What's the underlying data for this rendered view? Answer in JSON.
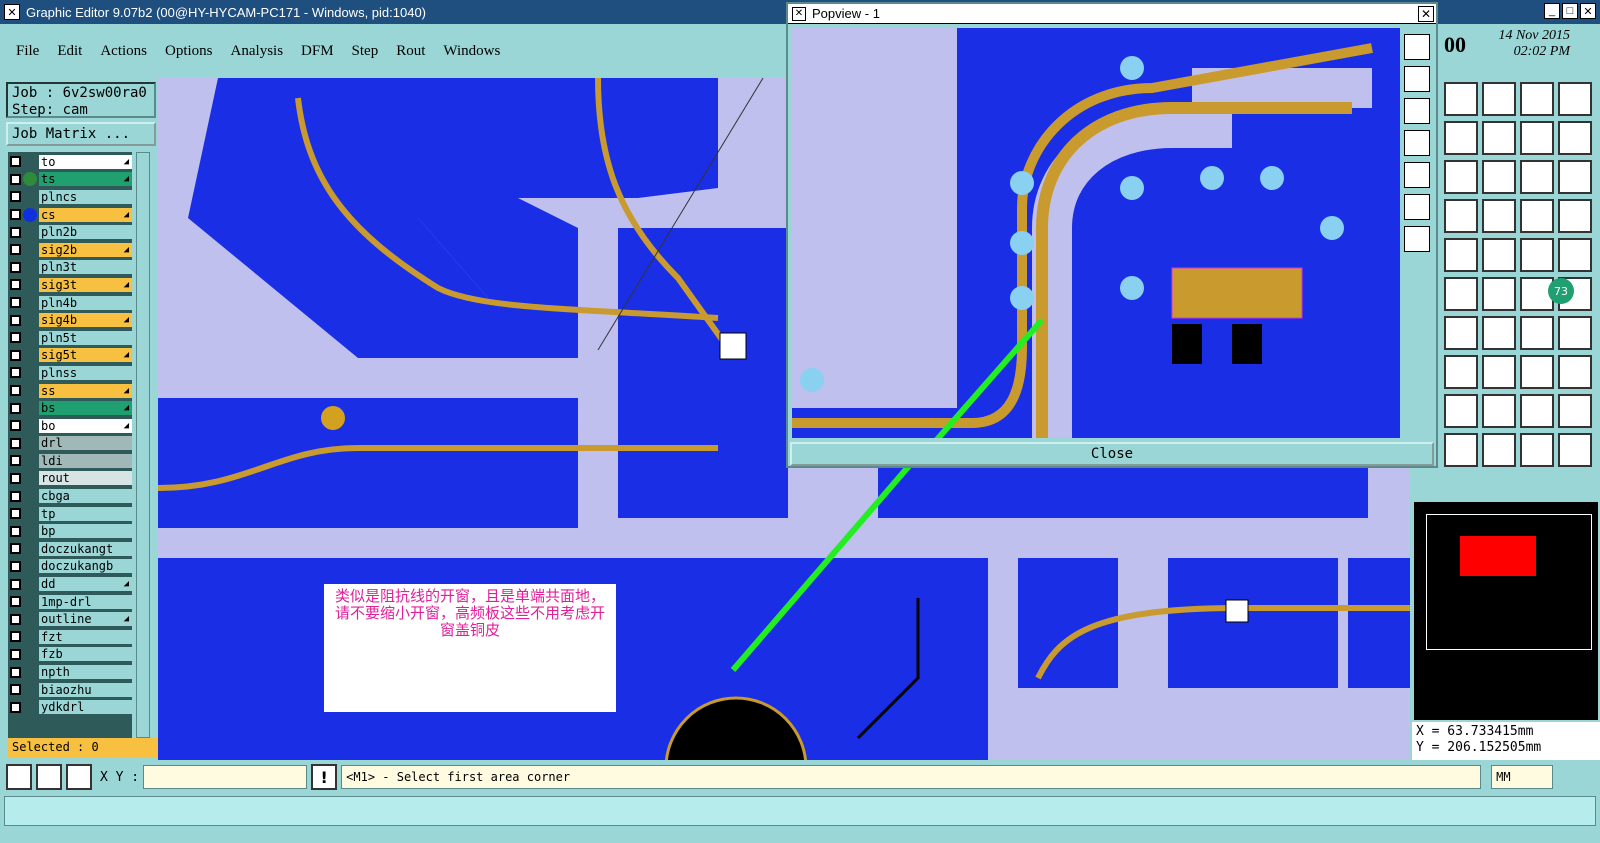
{
  "window": {
    "title": "Graphic Editor 9.07b2 (00@HY-HYCAM-PC171 - Windows, pid:1040)",
    "icon": "app-icon"
  },
  "menu": [
    "File",
    "Edit",
    "Actions",
    "Options",
    "Analysis",
    "DFM",
    "Step",
    "Rout",
    "Windows"
  ],
  "job": {
    "name_line": "Job : 6v2sw00ra0",
    "step_line": "Step: cam",
    "matrix_button": "Job Matrix ..."
  },
  "layers": [
    {
      "name": "to",
      "color": "#ffffff",
      "dot": "",
      "arrow": true
    },
    {
      "name": "ts",
      "color": "#20a070",
      "dot": "#2e8b3a",
      "arrow": true
    },
    {
      "name": "plncs",
      "color": "#9ad6d6",
      "dot": "",
      "arrow": false
    },
    {
      "name": "cs",
      "color": "#f8c040",
      "dot": "#1030e0",
      "arrow": true
    },
    {
      "name": "pln2b",
      "color": "#9ad6d6",
      "dot": "",
      "arrow": false
    },
    {
      "name": "sig2b",
      "color": "#f8c040",
      "dot": "",
      "arrow": true
    },
    {
      "name": "pln3t",
      "color": "#9ad6d6",
      "dot": "",
      "arrow": false
    },
    {
      "name": "sig3t",
      "color": "#f8c040",
      "dot": "",
      "arrow": true
    },
    {
      "name": "pln4b",
      "color": "#9ad6d6",
      "dot": "",
      "arrow": false
    },
    {
      "name": "sig4b",
      "color": "#f8c040",
      "dot": "",
      "arrow": true
    },
    {
      "name": "pln5t",
      "color": "#9ad6d6",
      "dot": "",
      "arrow": false
    },
    {
      "name": "sig5t",
      "color": "#f8c040",
      "dot": "",
      "arrow": true
    },
    {
      "name": "plnss",
      "color": "#9ad6d6",
      "dot": "",
      "arrow": false
    },
    {
      "name": "ss",
      "color": "#f8c040",
      "dot": "",
      "arrow": true
    },
    {
      "name": "bs",
      "color": "#20a070",
      "dot": "",
      "arrow": true
    },
    {
      "name": "bo",
      "color": "#ffffff",
      "dot": "",
      "arrow": true
    },
    {
      "name": "drl",
      "color": "#a0b8b8",
      "dot": "",
      "arrow": false
    },
    {
      "name": "ldi",
      "color": "#a0b8b8",
      "dot": "",
      "arrow": false
    },
    {
      "name": "rout",
      "color": "#d8e4e4",
      "dot": "",
      "arrow": false
    },
    {
      "name": "cbga",
      "color": "#9ad6d6",
      "dot": "",
      "arrow": false
    },
    {
      "name": "tp",
      "color": "#9ad6d6",
      "dot": "",
      "arrow": false
    },
    {
      "name": "bp",
      "color": "#9ad6d6",
      "dot": "",
      "arrow": false
    },
    {
      "name": "doczukangt",
      "color": "#9ad6d6",
      "dot": "",
      "arrow": false
    },
    {
      "name": "doczukangb",
      "color": "#9ad6d6",
      "dot": "",
      "arrow": false
    },
    {
      "name": "dd",
      "color": "#9ad6d6",
      "dot": "",
      "arrow": true
    },
    {
      "name": "1mp-drl",
      "color": "#9ad6d6",
      "dot": "",
      "arrow": false
    },
    {
      "name": "outline",
      "color": "#9ad6d6",
      "dot": "",
      "arrow": true
    },
    {
      "name": "fzt",
      "color": "#9ad6d6",
      "dot": "",
      "arrow": false
    },
    {
      "name": "fzb",
      "color": "#9ad6d6",
      "dot": "",
      "arrow": false
    },
    {
      "name": "npth",
      "color": "#9ad6d6",
      "dot": "",
      "arrow": false
    },
    {
      "name": "biaozhu",
      "color": "#9ad6d6",
      "dot": "",
      "arrow": false
    },
    {
      "name": "ydkdrl",
      "color": "#9ad6d6",
      "dot": "",
      "arrow": false
    }
  ],
  "selected_label": "Selected : 0",
  "popview": {
    "title": "Popview - 1",
    "close_label": "Close"
  },
  "clock": {
    "time_prefix": "00",
    "date": "14 Nov 2015",
    "time": "02:02 PM"
  },
  "coords": {
    "x": "X = 63.733415mm",
    "y": "Y = 206.152505mm"
  },
  "status": {
    "xy_label": "X Y :",
    "xy_value": "",
    "prompt": "<M1> - Select first area corner",
    "units": "MM"
  },
  "note_text": "类似是阻抗线的开窗，且是单端共面地，请不要缩小开窗，高频板这些不用考虑开窗盖铜皮",
  "canvas_badge": "73"
}
